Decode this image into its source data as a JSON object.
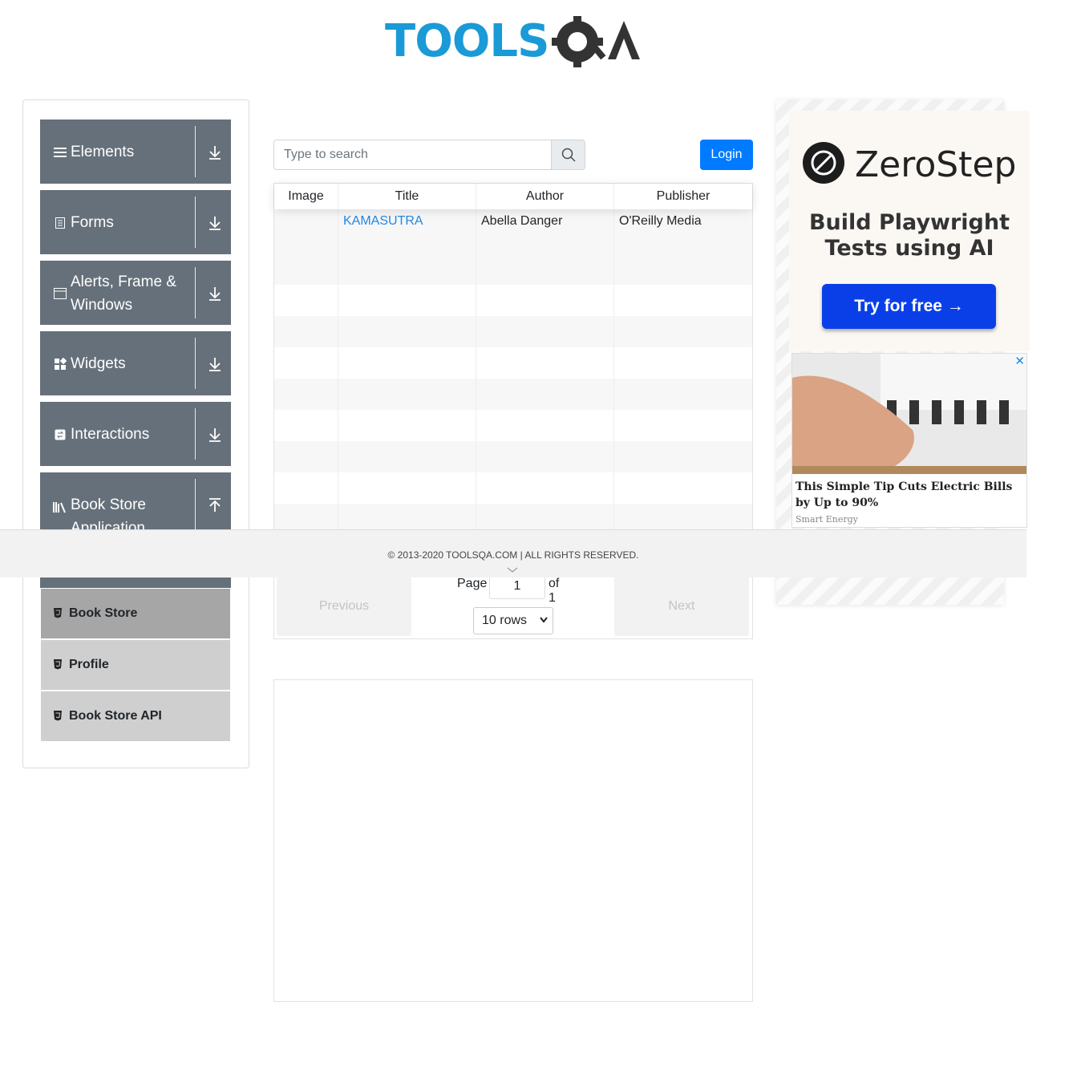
{
  "header": {
    "logo_text": "TOOLSQA"
  },
  "sidebar": {
    "groups": [
      {
        "label": "Elements",
        "icon": "hamburger-icon",
        "arrow": "download-arrow-icon"
      },
      {
        "label": "Forms",
        "icon": "document-icon",
        "arrow": "download-arrow-icon"
      },
      {
        "label": "Alerts, Frame & Windows",
        "icon": "window-icon",
        "arrow": "download-arrow-icon"
      },
      {
        "label": "Widgets",
        "icon": "widgets-icon",
        "arrow": "download-arrow-icon"
      },
      {
        "label": "Interactions",
        "icon": "interactions-icon",
        "arrow": "download-arrow-icon"
      },
      {
        "label": "Book Store Application",
        "icon": "library-icon",
        "arrow": "upload-arrow-icon"
      }
    ],
    "subitems": [
      {
        "label": "Book Store",
        "active": true
      },
      {
        "label": "Profile",
        "active": false
      },
      {
        "label": "Book Store API",
        "active": false
      }
    ]
  },
  "search": {
    "placeholder": "Type to search",
    "value": ""
  },
  "login": {
    "label": "Login"
  },
  "table": {
    "headers": [
      "Image",
      "Title",
      "Author",
      "Publisher"
    ],
    "rows": [
      {
        "image": "",
        "title": "KAMASUTRA",
        "author": "Abella Danger",
        "publisher": "O'Reilly Media"
      }
    ],
    "pagination": {
      "previous": "Previous",
      "next": "Next",
      "page_label": "Page",
      "page_value": "1",
      "of_label": "of 1",
      "rows_option": "10 rows"
    }
  },
  "ad_zerostep": {
    "brand": "ZeroStep",
    "tagline_line1": "Build Playwright",
    "tagline_line2": "Tests using AI",
    "button": "Try for free →"
  },
  "ad_energy": {
    "title": "This Simple Tip Cuts Electric Bills by Up to 90%",
    "source": "Smart Energy",
    "close": "✕"
  },
  "footer": {
    "text": "© 2013-2020 TOOLSQA.COM | ALL RIGHTS RESERVED."
  },
  "colors": {
    "primary": "#007bff",
    "sidebar_group": "#66707a",
    "link": "#1e88e5",
    "logo_blue": "#1a9ad6",
    "logo_dark": "#333333"
  }
}
